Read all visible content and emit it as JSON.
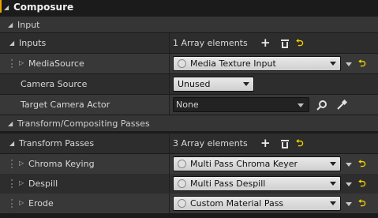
{
  "category": {
    "title": "Composure"
  },
  "sections": {
    "input": {
      "label": "Input"
    },
    "transform": {
      "label": "Transform/Compositing Passes"
    }
  },
  "rows": {
    "inputs": {
      "label": "Inputs",
      "value": "1 Array elements"
    },
    "media_source": {
      "label": "MediaSource",
      "value": "Media Texture Input"
    },
    "camera_source": {
      "label": "Camera Source",
      "value": "Unused"
    },
    "target_camera_actor": {
      "label": "Target Camera Actor",
      "value": "None"
    },
    "transform_passes": {
      "label": "Transform Passes",
      "value": "3 Array elements"
    },
    "chroma_keying": {
      "label": "Chroma Keying",
      "value": "Multi Pass Chroma Keyer"
    },
    "despill": {
      "label": "Despill",
      "value": "Multi Pass Despill"
    },
    "erode": {
      "label": "Erode",
      "value": "Custom Material Pass"
    }
  },
  "glyphs": {
    "reset": "⮌",
    "plus": "+",
    "expand": "▷",
    "collapse": "◢",
    "search": "⚲",
    "picker": "✎"
  },
  "colors": {
    "accent": "#e8a400",
    "reset_yellow": "#f2cf00"
  }
}
